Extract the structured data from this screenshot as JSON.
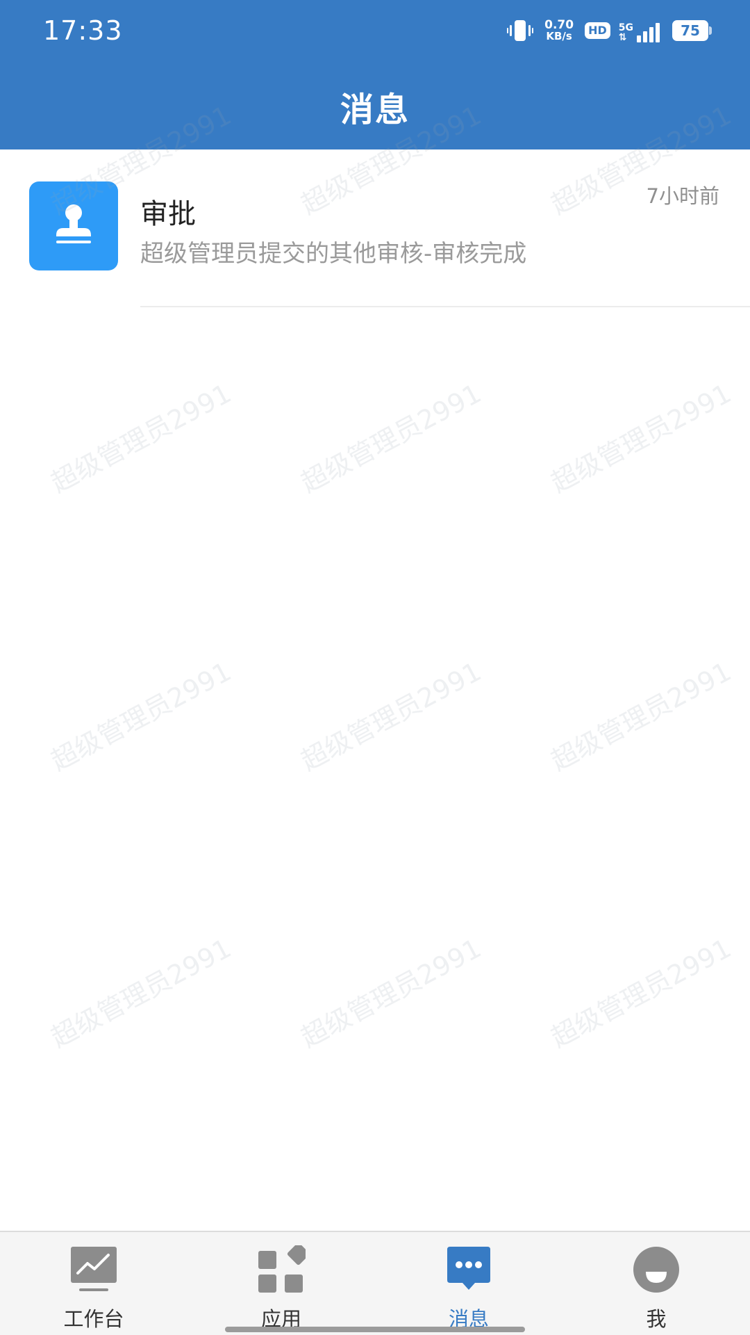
{
  "status_bar": {
    "time": "17:33",
    "net_speed_value": "0.70",
    "net_speed_unit": "KB/s",
    "hd_label": "HD",
    "network_label": "5G",
    "battery_level": "75",
    "icons": [
      "vibrate-icon",
      "hd-icon",
      "signal-icon",
      "battery-icon"
    ]
  },
  "header": {
    "title": "消息",
    "background_color": "#377BC4"
  },
  "watermark": {
    "text": "超级管理员2991"
  },
  "messages": [
    {
      "icon": "stamp-icon",
      "icon_bg": "#2E9BF7",
      "title": "审批",
      "time": "7小时前",
      "preview": "超级管理员提交的其他审核-审核完成"
    }
  ],
  "tabbar": {
    "active_color": "#377BC4",
    "tabs": [
      {
        "label": "工作台",
        "icon": "workbench-chart-icon",
        "active": false
      },
      {
        "label": "应用",
        "icon": "apps-grid-icon",
        "active": false
      },
      {
        "label": "消息",
        "icon": "message-bubble-icon",
        "active": true
      },
      {
        "label": "我",
        "icon": "profile-face-icon",
        "active": false
      }
    ]
  }
}
